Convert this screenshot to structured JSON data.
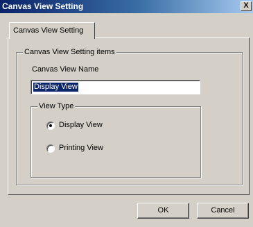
{
  "window": {
    "title": "Canvas View Setting",
    "close_glyph": "X"
  },
  "tabs": [
    {
      "label": "Canvas View Setting",
      "selected": true
    }
  ],
  "group": {
    "legend": "Canvas View Setting items",
    "name_label": "Canvas View Name",
    "name_value": "Display View"
  },
  "view_type": {
    "legend": "View Type",
    "options": [
      {
        "label": "Display View",
        "selected": true
      },
      {
        "label": "Printing View",
        "selected": false
      }
    ]
  },
  "buttons": {
    "ok": "OK",
    "cancel": "Cancel"
  },
  "colors": {
    "title_bar_start": "#0a246a",
    "title_bar_end": "#a6caf0",
    "face": "#d4d0c8",
    "selection": "#0a246a"
  }
}
